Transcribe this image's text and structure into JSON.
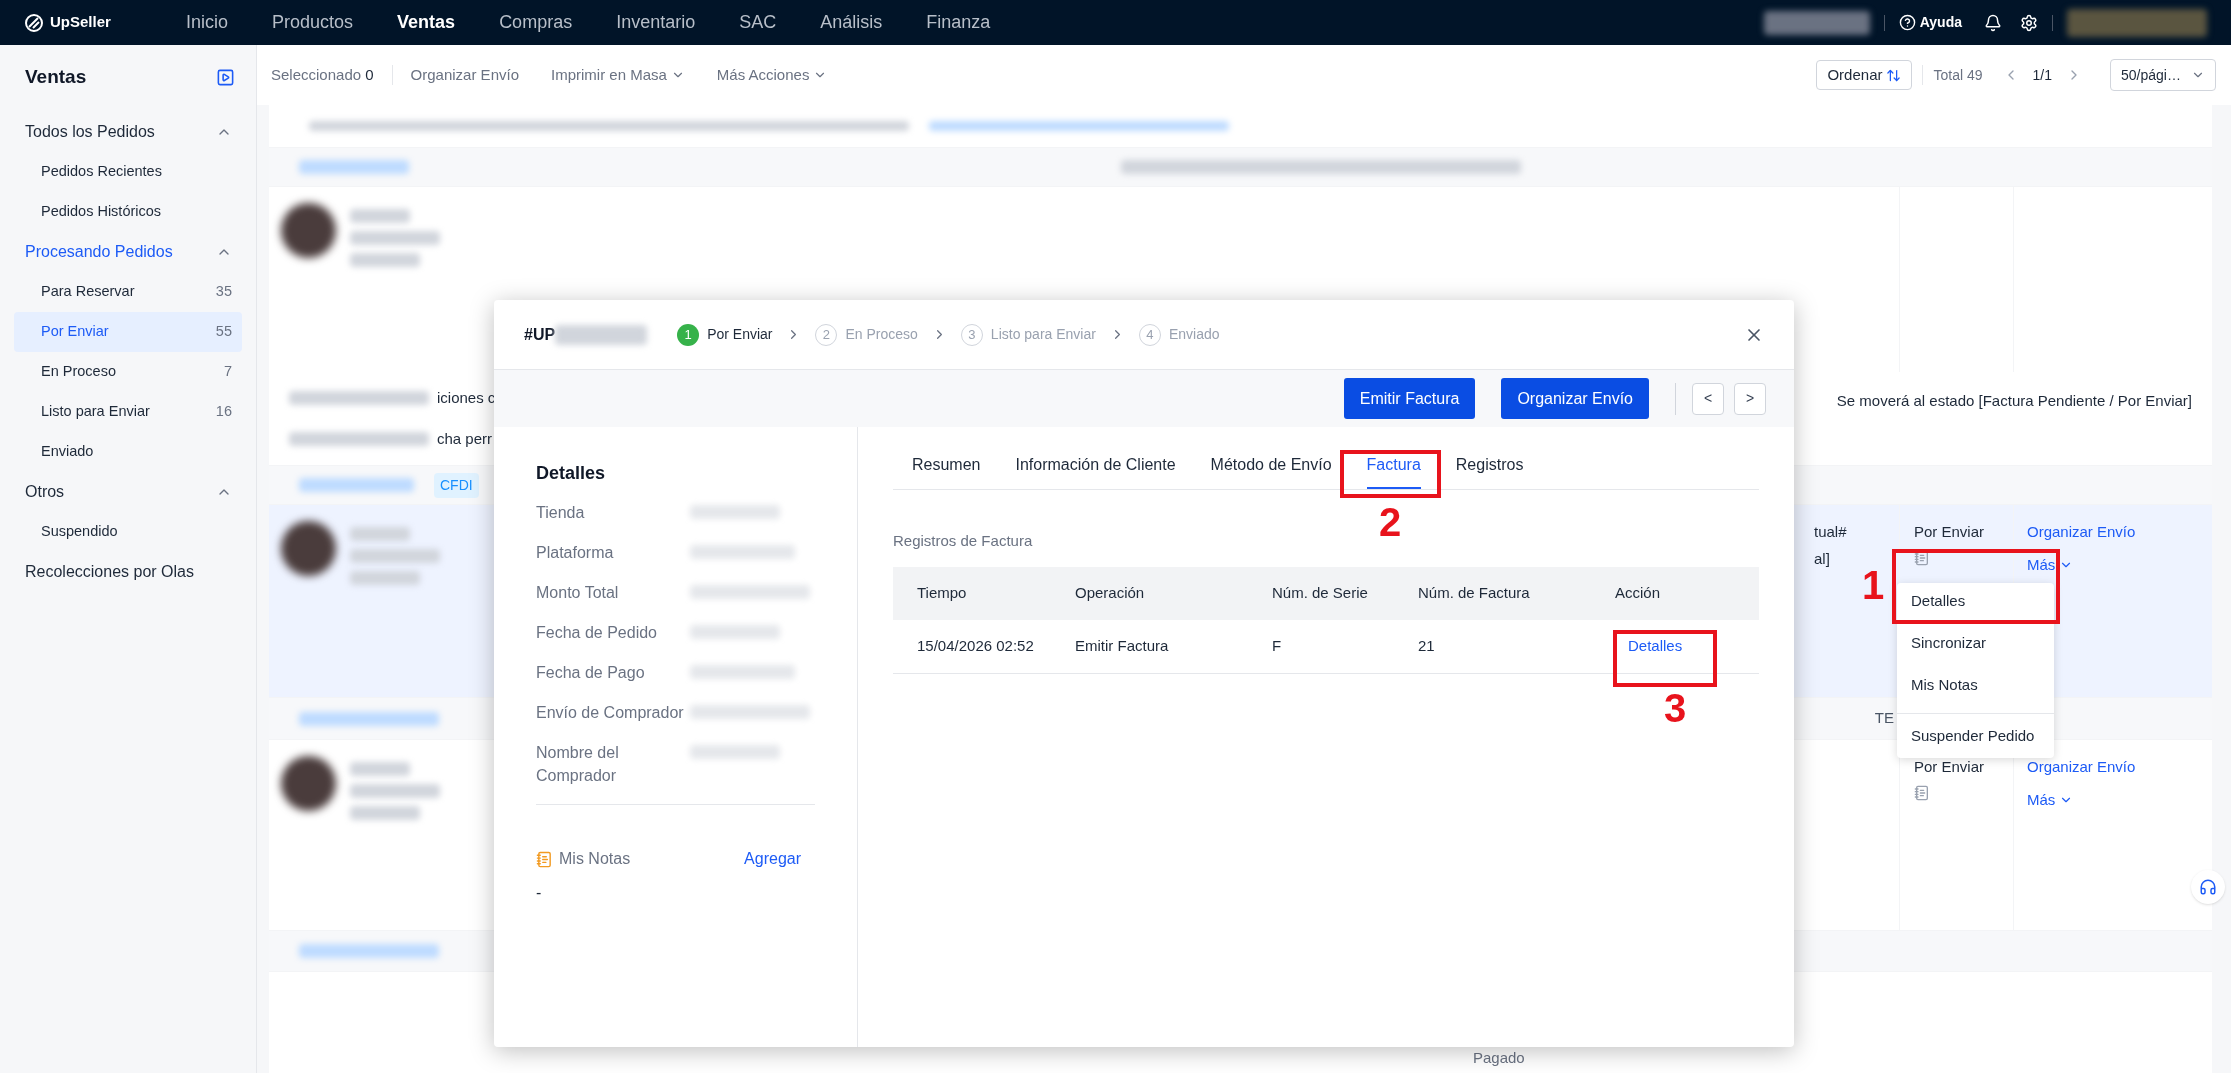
{
  "top_nav": {
    "logo": "UpSeller",
    "items": [
      {
        "label": "Inicio",
        "selected": false
      },
      {
        "label": "Productos",
        "selected": false
      },
      {
        "label": "Ventas",
        "selected": true
      },
      {
        "label": "Compras",
        "selected": false
      },
      {
        "label": "Inventario",
        "selected": false
      },
      {
        "label": "SAC",
        "selected": false
      },
      {
        "label": "Análisis",
        "selected": false
      },
      {
        "label": "Finanza",
        "selected": false
      }
    ],
    "help": "Ayuda"
  },
  "sidebar": {
    "title": "Ventas",
    "groups": [
      {
        "kind": "group",
        "label": "Todos los Pedidos",
        "active": false,
        "expanded": true,
        "children": [
          {
            "label": "Pedidos Recientes",
            "selected": false
          },
          {
            "label": "Pedidos Históricos",
            "selected": false
          }
        ]
      },
      {
        "kind": "group",
        "label": "Procesando Pedidos",
        "active": true,
        "expanded": true,
        "children": [
          {
            "label": "Para Reservar",
            "count": "35",
            "selected": false
          },
          {
            "label": "Por Enviar",
            "count": "55",
            "selected": true
          },
          {
            "label": "En Proceso",
            "count": "7",
            "selected": false
          },
          {
            "label": "Listo para Enviar",
            "count": "16",
            "selected": false
          },
          {
            "label": "Enviado",
            "selected": false
          }
        ]
      },
      {
        "kind": "group",
        "label": "Otros",
        "active": false,
        "expanded": true,
        "children": [
          {
            "label": "Suspendido",
            "selected": false
          }
        ]
      },
      {
        "kind": "link",
        "label": "Recolecciones por Olas",
        "active": false
      }
    ]
  },
  "toolbar": {
    "selected_label": "Seleccionado",
    "selected_count": "0",
    "actions": [
      {
        "label": "Organizar Envío",
        "dropdown": false
      },
      {
        "label": "Imprimir en Masa",
        "dropdown": true
      },
      {
        "label": "Más Acciones",
        "dropdown": true
      }
    ],
    "sort_button": "Ordenar",
    "total": "Total 49",
    "page": "1/1",
    "page_size": "50/pági…"
  },
  "orders_background": {
    "notice_fragments": [
      "iciones c",
      "cha perr"
    ],
    "notice_message": "Se moverá al estado [Factura Pendiente / Por Enviar]",
    "tag": "CFDI",
    "header_fragment": "TE",
    "last_status": "Pagado",
    "orders": [
      {
        "fragment_lines": [
          "tual#",
          "al]"
        ],
        "status": "Por Enviar",
        "primary_action": "Organizar Envío",
        "more": "Más",
        "highlighted": true
      },
      {
        "status": "Por Enviar",
        "primary_action": "Organizar Envío",
        "more": "Más",
        "highlighted": false
      }
    ]
  },
  "dropdown": {
    "items": [
      {
        "label": "Detalles",
        "divider_before": false
      },
      {
        "label": "Sincronizar",
        "divider_before": false
      },
      {
        "label": "Mis Notas",
        "divider_before": false
      },
      {
        "label": "Suspender Pedido",
        "divider_before": true
      }
    ]
  },
  "modal": {
    "order_prefix": "#UP",
    "steps": [
      {
        "number": "1",
        "label": "Por Enviar",
        "current": true
      },
      {
        "number": "2",
        "label": "En Proceso",
        "current": false
      },
      {
        "number": "3",
        "label": "Listo para Enviar",
        "current": false
      },
      {
        "number": "4",
        "label": "Enviado",
        "current": false
      }
    ],
    "buttons": [
      "Emitir Factura",
      "Organizar Envío"
    ],
    "nav_buttons": [
      "<",
      ">"
    ],
    "details": {
      "title": "Detalles",
      "fields": [
        {
          "label": "Tienda"
        },
        {
          "label": "Plataforma"
        },
        {
          "label": "Monto Total"
        },
        {
          "label": "Fecha de Pedido"
        },
        {
          "label": "Fecha de Pago"
        },
        {
          "label": "Envío de Comprador"
        },
        {
          "label": "Nombre del Comprador"
        }
      ],
      "notes_title": "Mis Notas",
      "notes_action": "Agregar",
      "notes_value": "-"
    },
    "tabs": [
      {
        "label": "Resumen",
        "selected": false
      },
      {
        "label": "Información de Cliente",
        "selected": false
      },
      {
        "label": "Método de Envío",
        "selected": false
      },
      {
        "label": "Factura",
        "selected": true
      },
      {
        "label": "Registros",
        "selected": false
      }
    ],
    "section_title": "Registros de Factura",
    "table": {
      "columns": [
        "Tiempo",
        "Operación",
        "Núm. de Serie",
        "Núm. de Factura",
        "Acción"
      ],
      "rows": [
        {
          "cells": [
            "15/04/2026 02:52",
            "Emitir Factura",
            "F",
            "21"
          ],
          "action": "Detalles"
        }
      ]
    }
  },
  "annotations": [
    {
      "label": "1"
    },
    {
      "label": "2"
    },
    {
      "label": "3"
    }
  ]
}
